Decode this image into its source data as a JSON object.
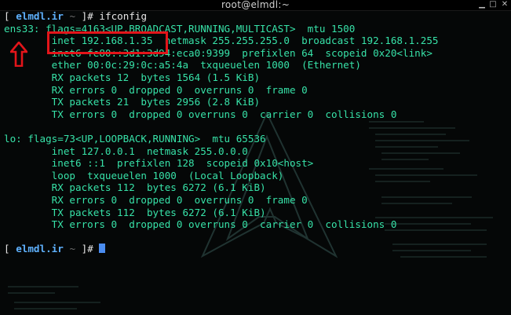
{
  "window": {
    "title": "root@elmdl:~",
    "buttons": {
      "minimize": "▁",
      "maximize": "□",
      "close": "✕"
    }
  },
  "prompt": {
    "open_bracket": "[",
    "host": "elmdl.ir",
    "tilde": "~",
    "close_bracket": "]#",
    "command": "ifconfig"
  },
  "output": {
    "ens33": [
      "ens33: flags=4163<UP,BROADCAST,RUNNING,MULTICAST>  mtu 1500",
      "        inet 192.168.1.35  netmask 255.255.255.0  broadcast 192.168.1.255",
      "        inet6 fe80::3d1:3d94:eca0:9399  prefixlen 64  scopeid 0x20<link>",
      "        ether 00:0c:29:0c:a5:4a  txqueuelen 1000  (Ethernet)",
      "        RX packets 12  bytes 1564 (1.5 KiB)",
      "        RX errors 0  dropped 0  overruns 0  frame 0",
      "        TX packets 21  bytes 2956 (2.8 KiB)",
      "        TX errors 0  dropped 0 overruns 0  carrier 0  collisions 0"
    ],
    "lo": [
      "lo: flags=73<UP,LOOPBACK,RUNNING>  mtu 65536",
      "        inet 127.0.0.1  netmask 255.0.0.0",
      "        inet6 ::1  prefixlen 128  scopeid 0x10<host>",
      "        loop  txqueuelen 1000  (Local Loopback)",
      "        RX packets 112  bytes 6272 (6.1 KiB)",
      "        RX errors 0  dropped 0  overruns 0  frame 0",
      "        TX packets 112  bytes 6272 (6.1 KiB)",
      "        TX errors 0  dropped 0 overruns 0  carrier 0  collisions 0"
    ]
  },
  "colors": {
    "terminal_text": "#37e2a8",
    "prompt_host": "#5fb2ff",
    "cursor": "#4a8cf0",
    "annotation": "#e3151a",
    "background": "#050707"
  },
  "icons": {
    "annotation_arrow": "up-arrow-icon",
    "background_logo": "arch-linux-logo-icon"
  }
}
